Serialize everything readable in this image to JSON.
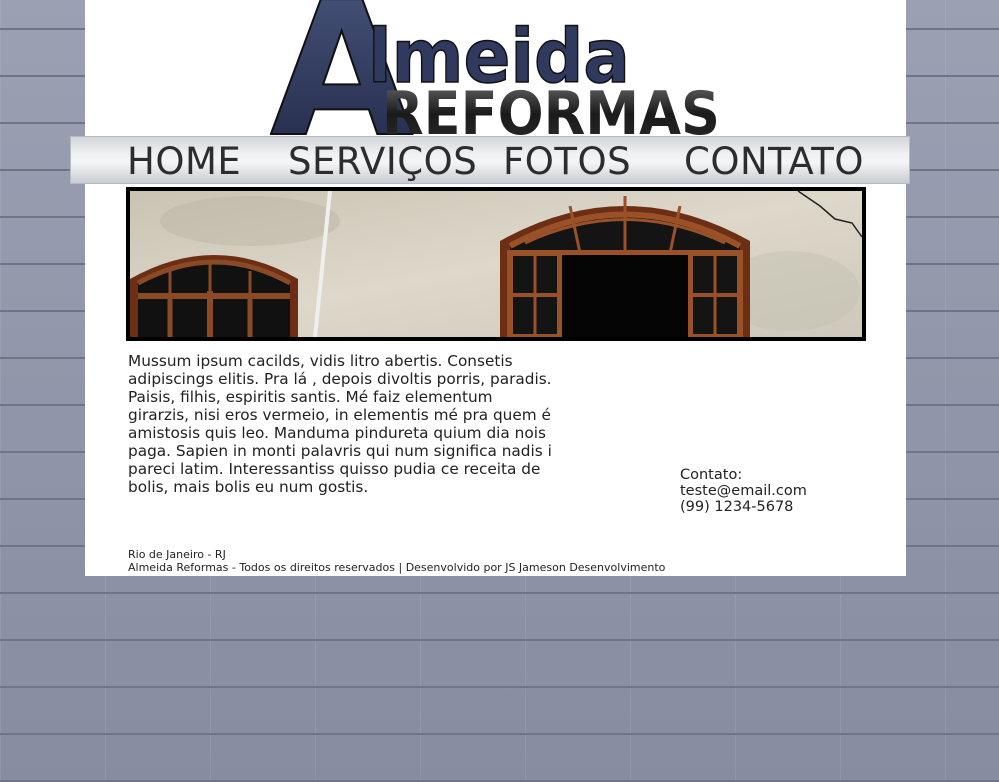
{
  "logo": {
    "big_letter": "A",
    "top_word": "lmeida",
    "bottom_word": "REFORMAS"
  },
  "nav": {
    "items": [
      {
        "label": "HOME"
      },
      {
        "label": "SERVIÇOS"
      },
      {
        "label": "FOTOS"
      },
      {
        "label": "CONTATO"
      }
    ]
  },
  "content": {
    "paragraph": "Mussum ipsum cacilds, vidis litro abertis. Consetis adipiscings elitis. Pra lá , depois divoltis porris, paradis. Paisis, filhis, espiritis santis. Mé faiz elementum girarzis, nisi eros vermeio, in elementis mé pra quem é amistosis quis leo. Manduma pindureta quium dia nois paga. Sapien in monti palavris qui num significa nadis i pareci latim. Interessantiss quisso pudia ce receita de bolis, mais bolis eu num gostis."
  },
  "contact": {
    "title": "Contato:",
    "email": "teste@email.com",
    "phone": "(99) 1234-5678"
  },
  "footer": {
    "location": "Rio de Janeiro - RJ",
    "credits": "Almeida Reformas - Todos os direitos reservados | Desenvolvido por JS Jameson Desenvolvimento"
  },
  "colors": {
    "logo_navy": "#2f3a5e",
    "logo_dark": "#1e1e1e",
    "page_bg": "#ffffff",
    "wall_bg": "#8f95a8",
    "window_frame": "#7a3a1c"
  }
}
